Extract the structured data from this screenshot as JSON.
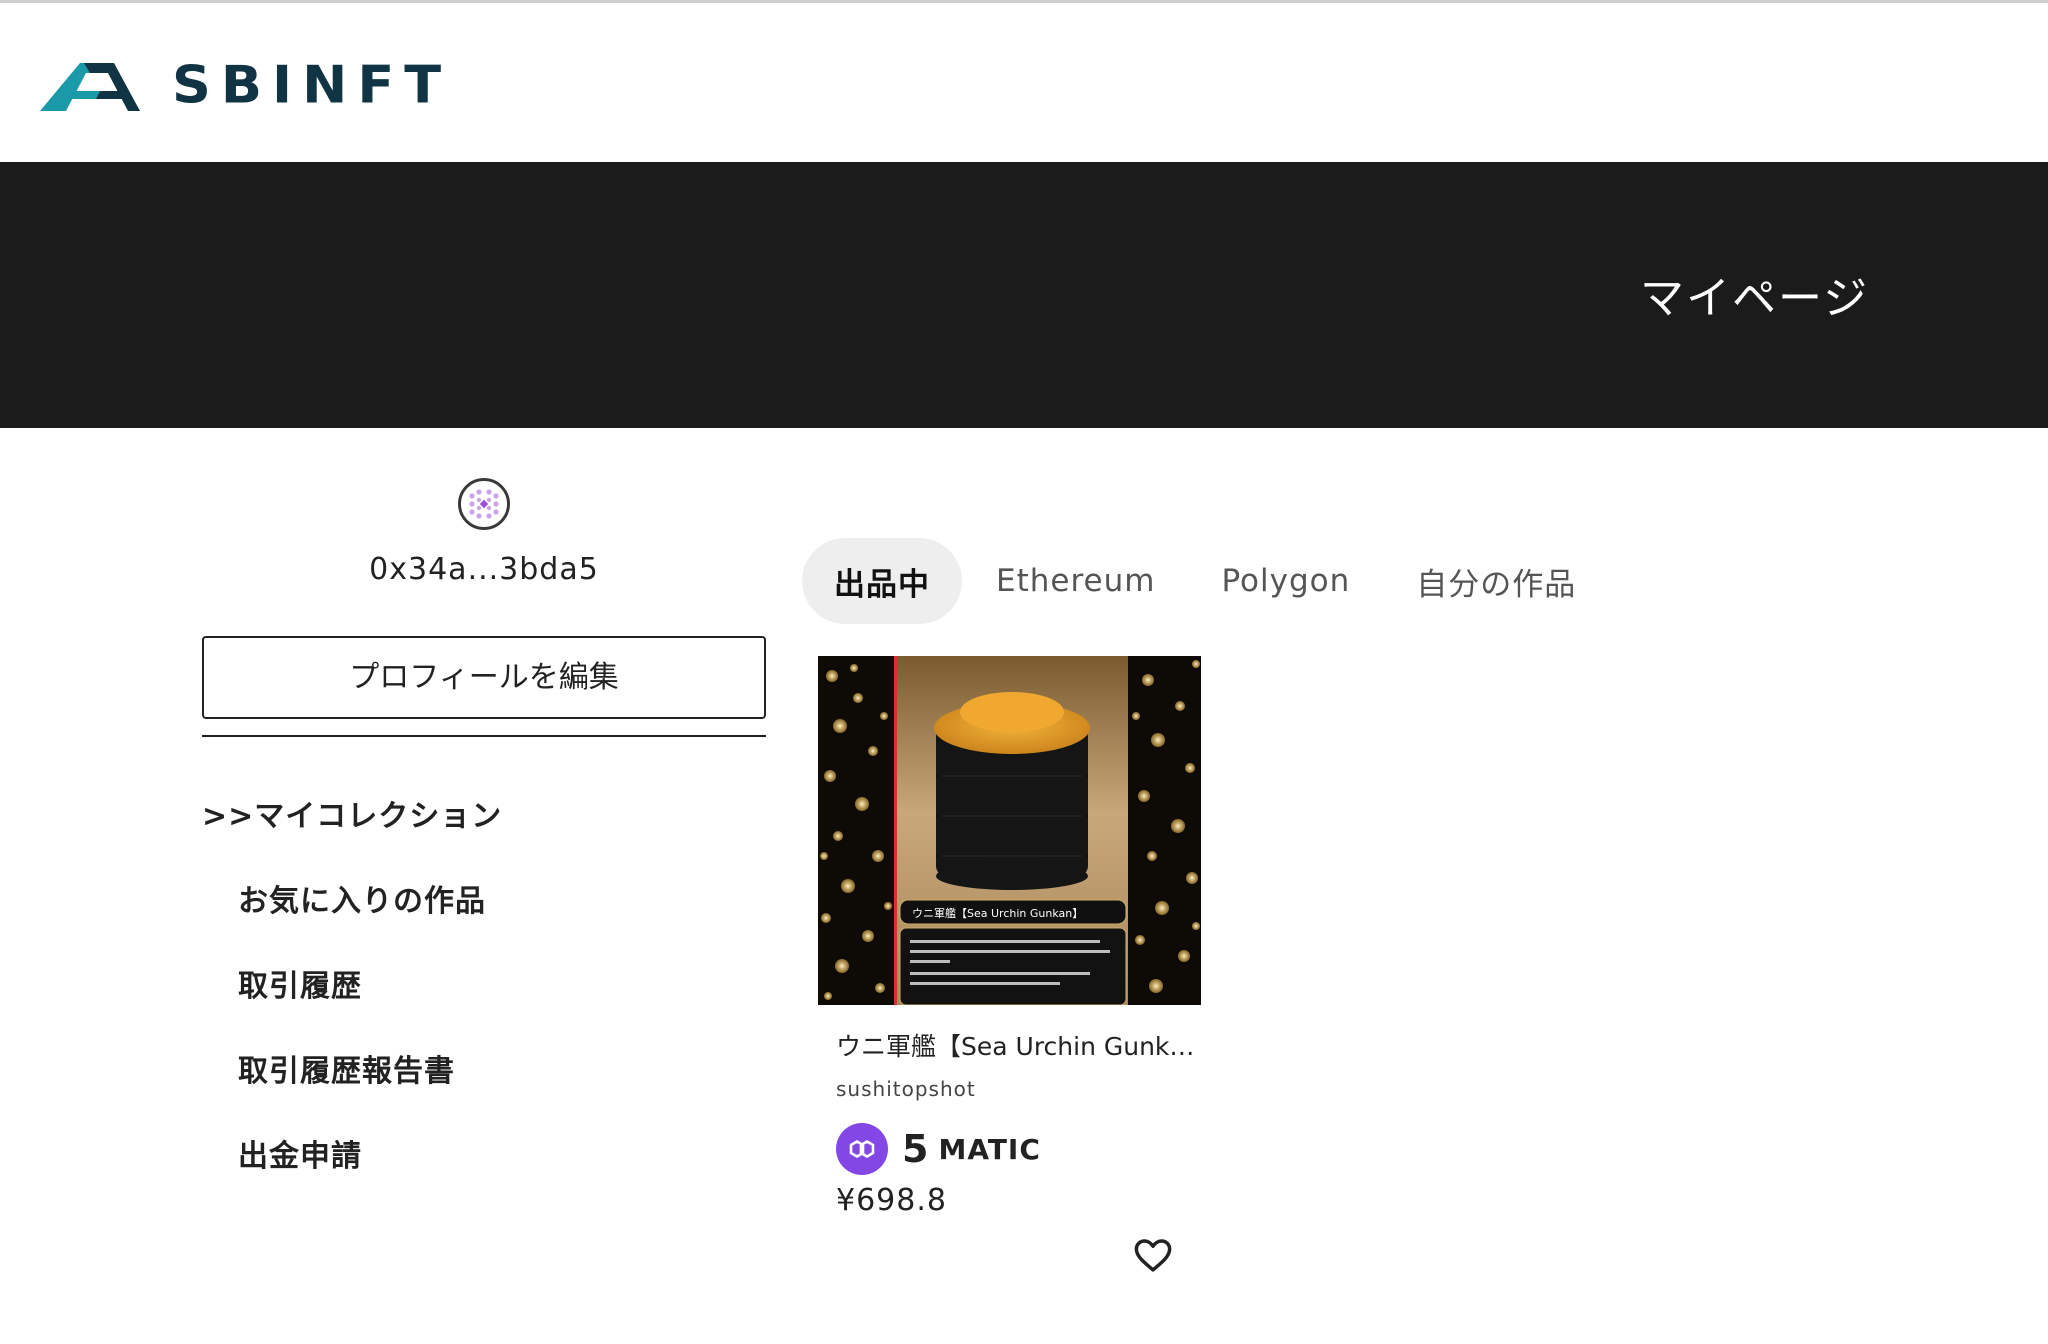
{
  "brand": {
    "name": "SBINFT",
    "colors": {
      "teal": "#1a9aa8",
      "navy": "#113444"
    }
  },
  "banner": {
    "title": "マイページ"
  },
  "profile": {
    "avatar_icon": "identicon-avatar",
    "address": "0x34a...3bda5",
    "edit_button": "プロフィールを編集"
  },
  "menu": {
    "items": [
      {
        "label": ">>マイコレクション",
        "active": true
      },
      {
        "label": "お気に入りの作品"
      },
      {
        "label": "取引履歴"
      },
      {
        "label": "取引履歴報告書"
      },
      {
        "label": "出金申請"
      }
    ]
  },
  "tabs": [
    {
      "label": "出品中",
      "active": true
    },
    {
      "label": "Ethereum"
    },
    {
      "label": "Polygon"
    },
    {
      "label": "自分の作品"
    }
  ],
  "card": {
    "title": "ウニ軍艦【Sea Urchin Gunk…",
    "owner": "sushitopshot",
    "price": "5",
    "currency": "MATIC",
    "fiat": "¥698.8",
    "image_caption": "ウニ軍艦【Sea Urchin Gunkan】",
    "currency_icon": "polygon-matic-icon",
    "favorite_icon": "heart-icon"
  }
}
